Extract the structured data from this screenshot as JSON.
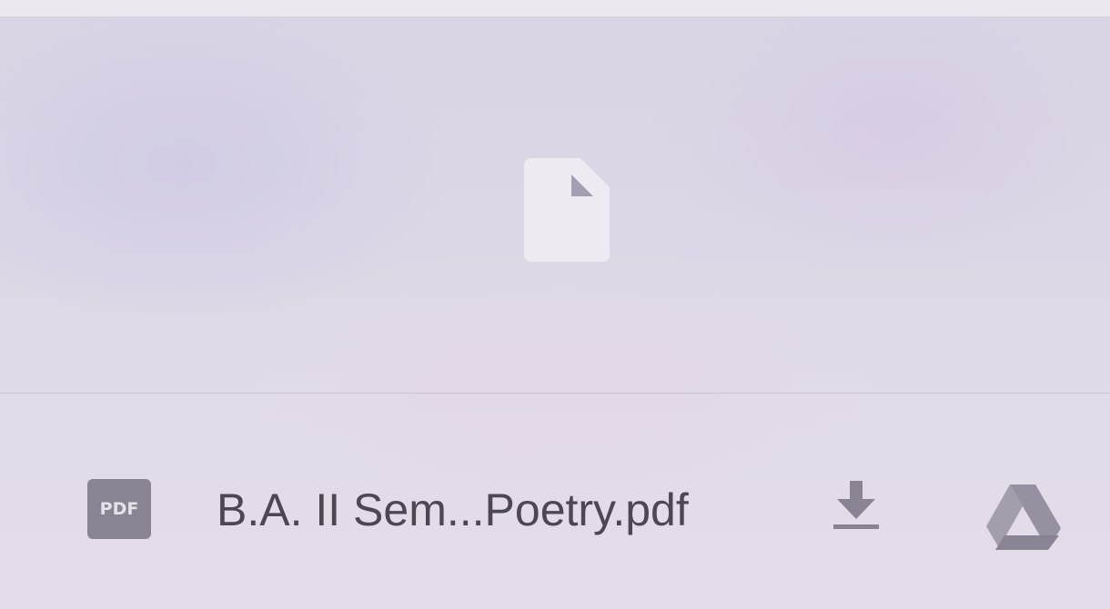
{
  "file": {
    "type_badge": "PDF",
    "name": "B.A. II Sem...Poetry.pdf"
  },
  "icons": {
    "preview": "generic-file-icon",
    "type": "pdf-icon",
    "download": "download-icon",
    "drive": "google-drive-icon"
  },
  "colors": {
    "icon_gray": "#8a8393",
    "preview_icon": "#efeaf2",
    "text": "#4d4752"
  }
}
